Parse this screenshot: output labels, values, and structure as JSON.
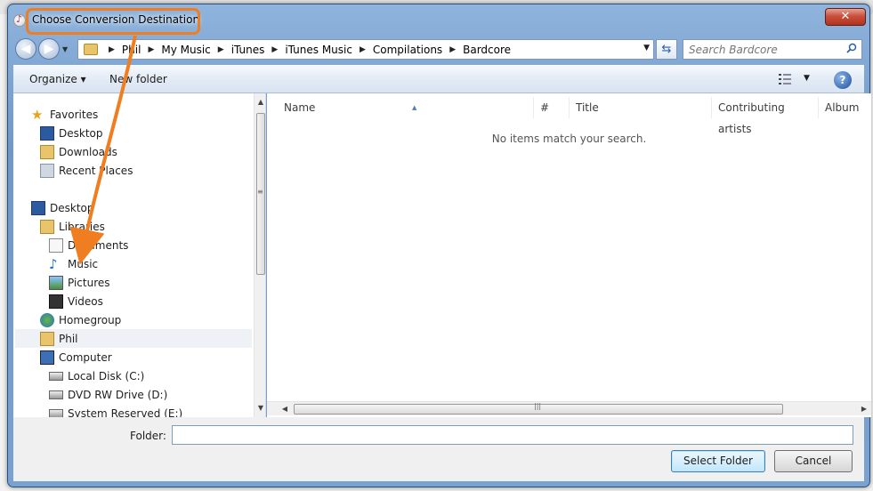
{
  "dialog": {
    "title": "Choose Conversion Destination",
    "close_label": "✕"
  },
  "address": {
    "breadcrumb": [
      "Phil",
      "My Music",
      "iTunes",
      "iTunes Music",
      "Compilations",
      "Bardcore"
    ],
    "search_placeholder": "Search Bardcore"
  },
  "toolbar": {
    "organize_label": "Organize ▾",
    "new_folder_label": "New folder",
    "help_label": "?"
  },
  "nav_tree": {
    "favorites": "Favorites",
    "desktop_fav": "Desktop",
    "downloads": "Downloads",
    "recent_places": "Recent Places",
    "desktop": "Desktop",
    "libraries": "Libraries",
    "documents": "Documents",
    "music": "Music",
    "pictures": "Pictures",
    "videos": "Videos",
    "homegroup": "Homegroup",
    "phil": "Phil",
    "computer": "Computer",
    "local_disk": "Local Disk (C:)",
    "dvd_drive": "DVD RW Drive (D:)",
    "system_reserved": "System Reserved (E:)"
  },
  "file_list": {
    "columns": [
      "Name",
      "#",
      "Title",
      "Contributing artists",
      "Album"
    ],
    "empty_message": "No items match your search."
  },
  "footer": {
    "folder_label": "Folder:",
    "folder_value": "",
    "select_button": "Select Folder",
    "cancel_button": "Cancel"
  },
  "colors": {
    "callout": "#f07d1f",
    "frame": "#7aa2d0"
  }
}
